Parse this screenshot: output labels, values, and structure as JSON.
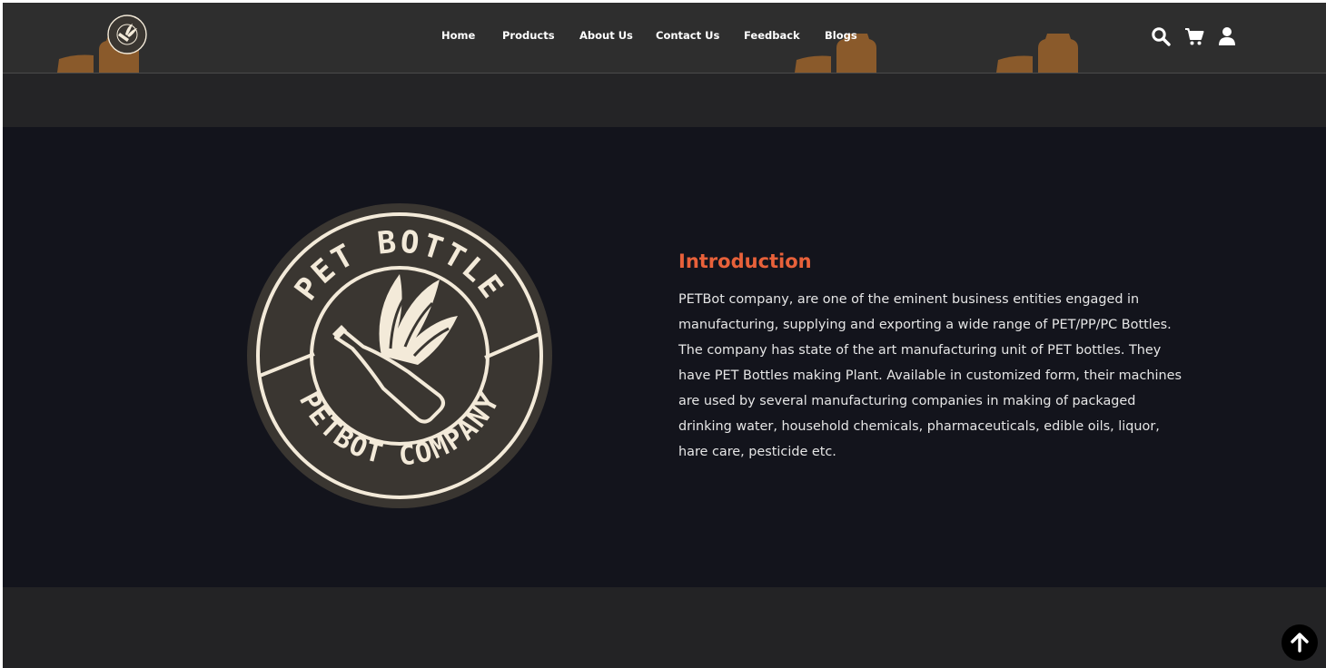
{
  "brand": {
    "logo_ring_top_text": "PET BOTTLE",
    "logo_ring_bottom_text": "PETBOT COMPANY"
  },
  "nav": {
    "items": [
      {
        "label": "Home"
      },
      {
        "label": "Products"
      },
      {
        "label": "About Us"
      },
      {
        "label": "Contact Us"
      },
      {
        "label": "Feedback"
      },
      {
        "label": "Blogs"
      }
    ]
  },
  "header_icons": [
    "search-icon",
    "cart-icon",
    "user-icon"
  ],
  "intro": {
    "title": "Introduction",
    "text": "PETBot company, are one of the eminent business entities engaged in manufacturing, supplying and exporting a wide range of PET/PP/PC Bottles. The company has state of the art manufacturing unit of PET bottles. They have PET Bottles making Plant. Available in customized form, their machines are used by several manufacturing companies in making of packaged drinking water, household chemicals, pharmaceuticals, edible oils, liquor, hare care, pesticide etc."
  },
  "colors": {
    "header_bg": "#2e2e2e",
    "intro_bg": "#13141c",
    "accent": "#e8613a",
    "bottle_deco": "#8a5a2b",
    "logo_cream": "#f3ead9",
    "logo_dark": "#3a3631"
  },
  "scroll_top_icon": "arrow-up-icon"
}
